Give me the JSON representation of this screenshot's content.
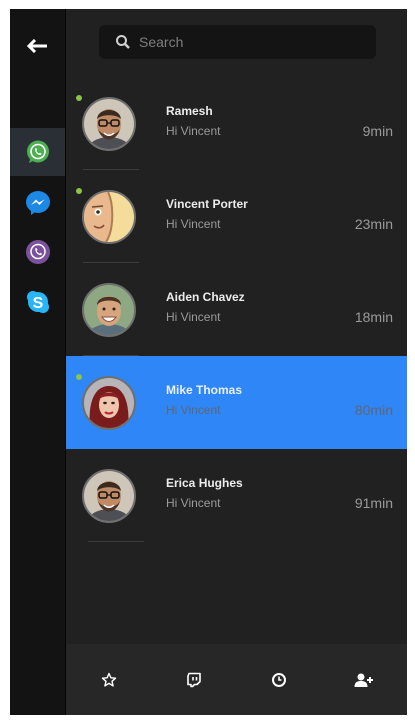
{
  "search": {
    "placeholder": "Search"
  },
  "sidebar": {
    "back_icon": "arrow-left-icon",
    "apps": [
      {
        "name": "whatsapp",
        "icon": "whatsapp-icon",
        "color": "#4CAF50",
        "active": true
      },
      {
        "name": "messenger",
        "icon": "messenger-icon",
        "color": "#1E88E5",
        "active": false
      },
      {
        "name": "viber",
        "icon": "viber-icon",
        "color": "#7B519D",
        "active": false
      },
      {
        "name": "skype",
        "icon": "skype-icon",
        "color": "#29B6F6",
        "active": false
      }
    ]
  },
  "chats": [
    {
      "name": "Ramesh",
      "message": "Hi Vincent",
      "time": "9min",
      "online": true,
      "active": false
    },
    {
      "name": "Vincent Porter",
      "message": "Hi Vincent",
      "time": "23min",
      "online": true,
      "active": false
    },
    {
      "name": "Aiden Chavez",
      "message": "Hi Vincent",
      "time": "18min",
      "online": false,
      "active": false
    },
    {
      "name": "Mike Thomas",
      "message": "Hi Vincent",
      "time": "80min",
      "online": true,
      "active": true
    },
    {
      "name": "Erica Hughes",
      "message": "Hi Vincent",
      "time": "91min",
      "online": false,
      "active": false
    }
  ],
  "bottom_bar": [
    {
      "icon": "star-icon"
    },
    {
      "icon": "twitch-icon"
    },
    {
      "icon": "clock-icon"
    },
    {
      "icon": "add-user-icon"
    }
  ],
  "colors": {
    "accent": "#2F86F6",
    "online": "#8BC34A",
    "background": "#212121",
    "sidebar": "#131313"
  }
}
